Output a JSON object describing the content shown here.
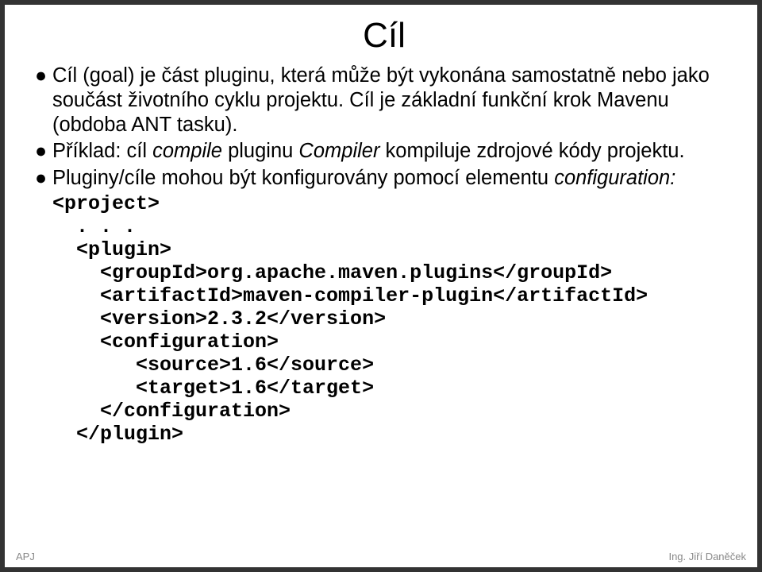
{
  "title": "Cíl",
  "bullets": [
    {
      "parts": [
        {
          "text": "Cíl (goal) je část pluginu, která může být vykonána samostatně nebo jako součást životního cyklu projektu. Cíl je základní  funkční krok Mavenu (obdoba ANT tasku).",
          "italic": false
        }
      ]
    },
    {
      "parts": [
        {
          "text": "Příklad: cíl ",
          "italic": false
        },
        {
          "text": "compile",
          "italic": true
        },
        {
          "text": " pluginu ",
          "italic": false
        },
        {
          "text": "Compiler",
          "italic": true
        },
        {
          "text": " kompiluje zdrojové kódy projektu.",
          "italic": false
        }
      ]
    },
    {
      "parts": [
        {
          "text": "Pluginy/cíle mohou být konfigurovány pomocí elementu ",
          "italic": false
        },
        {
          "text": "configuration:",
          "italic": true
        }
      ]
    }
  ],
  "code": "<project>\n  . . .\n  <plugin>\n    <groupId>org.apache.maven.plugins</groupId>\n    <artifactId>maven-compiler-plugin</artifactId>\n    <version>2.3.2</version>\n    <configuration>\n       <source>1.6</source>\n       <target>1.6</target>\n    </configuration>\n  </plugin>",
  "footer": {
    "left": "APJ",
    "right": "Ing. Jiří Daněček"
  }
}
